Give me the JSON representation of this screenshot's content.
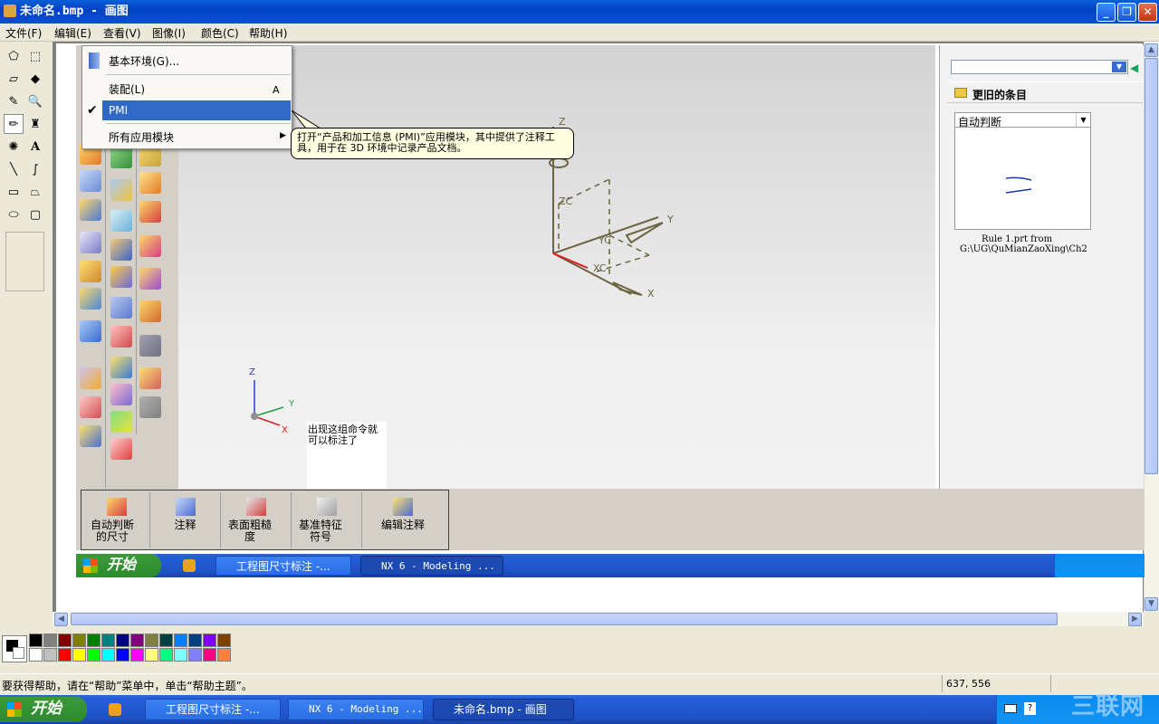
{
  "window": {
    "title": "未命名.bmp - 画图"
  },
  "menubar": [
    "文件(F)",
    "编辑(E)",
    "查看(V)",
    "图像(I)",
    "颜色(C)",
    "帮助(H)"
  ],
  "palette": [
    "#000000",
    "#808080",
    "#800000",
    "#808000",
    "#008000",
    "#008080",
    "#000080",
    "#800080",
    "#808040",
    "#004040",
    "#0080ff",
    "#004080",
    "#8000ff",
    "#804000",
    "#ffffff",
    "#c0c0c0",
    "#ff0000",
    "#ffff00",
    "#00ff00",
    "#00ffff",
    "#0000ff",
    "#ff00ff",
    "#ffff80",
    "#00ff80",
    "#80ffff",
    "#8080ff",
    "#ff0080",
    "#ff8040"
  ],
  "status": {
    "help": "要获得帮助，请在“帮助”菜单中，单击“帮助主题”。",
    "coords": "637, 556"
  },
  "taskbar": {
    "start": "开始",
    "buttons": [
      "工程图尺寸标注 -...",
      "NX 6 - Modeling ...",
      "未命名.bmp - 画图"
    ],
    "watermark": "三联网"
  },
  "nx": {
    "menu": {
      "items": [
        "基本环境(G)...",
        "装配(L)",
        "PMI",
        "所有应用模块"
      ],
      "shortcut": "A",
      "selected": "PMI"
    },
    "tooltip": "打开“产品和加工信息 (PMI)”应用模块，其中提供了注释工具，用于在 3D 环境中记录产品文档。",
    "axes_main": {
      "z": "Z",
      "zc": "ZC",
      "yc": "YC",
      "xc": "XC",
      "y": "Y",
      "x": "X"
    },
    "axes_small": {
      "z": "Z",
      "y": "Y",
      "x": "X"
    },
    "note": "出现这组命令就可以标注了",
    "right_panel": {
      "header": "更旧的条目",
      "dropdown": "自动判断",
      "caption": [
        "Rule 1.prt from",
        "G:\\UG\\QuMianZaoXing\\Ch2"
      ]
    },
    "toolbar": [
      "自动判断的尺寸",
      "注释",
      "表面粗糙度",
      "基准特征符号",
      "编辑注释"
    ],
    "inner_taskbar": {
      "start": "开始",
      "buttons": [
        "工程图尺寸标注 -...",
        "NX 6 - Modeling ..."
      ]
    }
  }
}
